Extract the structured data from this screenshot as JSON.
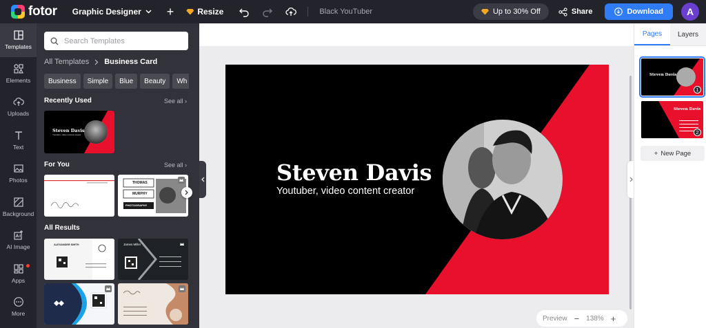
{
  "topbar": {
    "logo_text": "fotor",
    "mode_select": "Graphic Designer",
    "resize_label": "Resize",
    "document_title": "Black YouTuber",
    "promo_label": "Up to 30% Off",
    "share_label": "Share",
    "download_label": "Download",
    "avatar_initial": "A"
  },
  "rail": {
    "items": [
      {
        "label": "Templates",
        "icon": "templates-icon"
      },
      {
        "label": "Elements",
        "icon": "elements-icon"
      },
      {
        "label": "Uploads",
        "icon": "cloud-upload-icon"
      },
      {
        "label": "Text",
        "icon": "text-icon"
      },
      {
        "label": "Photos",
        "icon": "photo-icon"
      },
      {
        "label": "Background",
        "icon": "background-icon"
      },
      {
        "label": "AI Image",
        "icon": "ai-image-icon"
      },
      {
        "label": "Apps",
        "icon": "apps-icon"
      },
      {
        "label": "More",
        "icon": "more-icon"
      }
    ]
  },
  "panel": {
    "search_placeholder": "Search Templates",
    "breadcrumb_root": "All Templates",
    "breadcrumb_current": "Business Card",
    "chips": [
      "Business",
      "Simple",
      "Blue",
      "Beauty",
      "Wh"
    ],
    "recently_used": "Recently Used",
    "for_you": "For You",
    "all_results": "All Results",
    "see_all": "See all"
  },
  "thumbs": {
    "recent_name": "Steven Davis",
    "recent_role": "Youtuber, video content creator",
    "fy2_line1": "THOMAS",
    "fy2_line2": "MURPHY",
    "fy2_line3": "PHOTOGRAPHY",
    "ar1_name": "ALEXANDER SMITH",
    "ar2_name": "James Miller"
  },
  "card": {
    "name": "Steven Davis",
    "role": "Youtuber, video content creator",
    "bg_color": "#000000",
    "accent_color": "#e8102a"
  },
  "zoom": {
    "preview_label": "Preview",
    "minus": "−",
    "level": "138%",
    "plus": "+"
  },
  "right_panel": {
    "tab_pages": "Pages",
    "tab_layers": "Layers",
    "page1_num": "1",
    "page2_num": "2",
    "new_page_label": "New Page"
  }
}
